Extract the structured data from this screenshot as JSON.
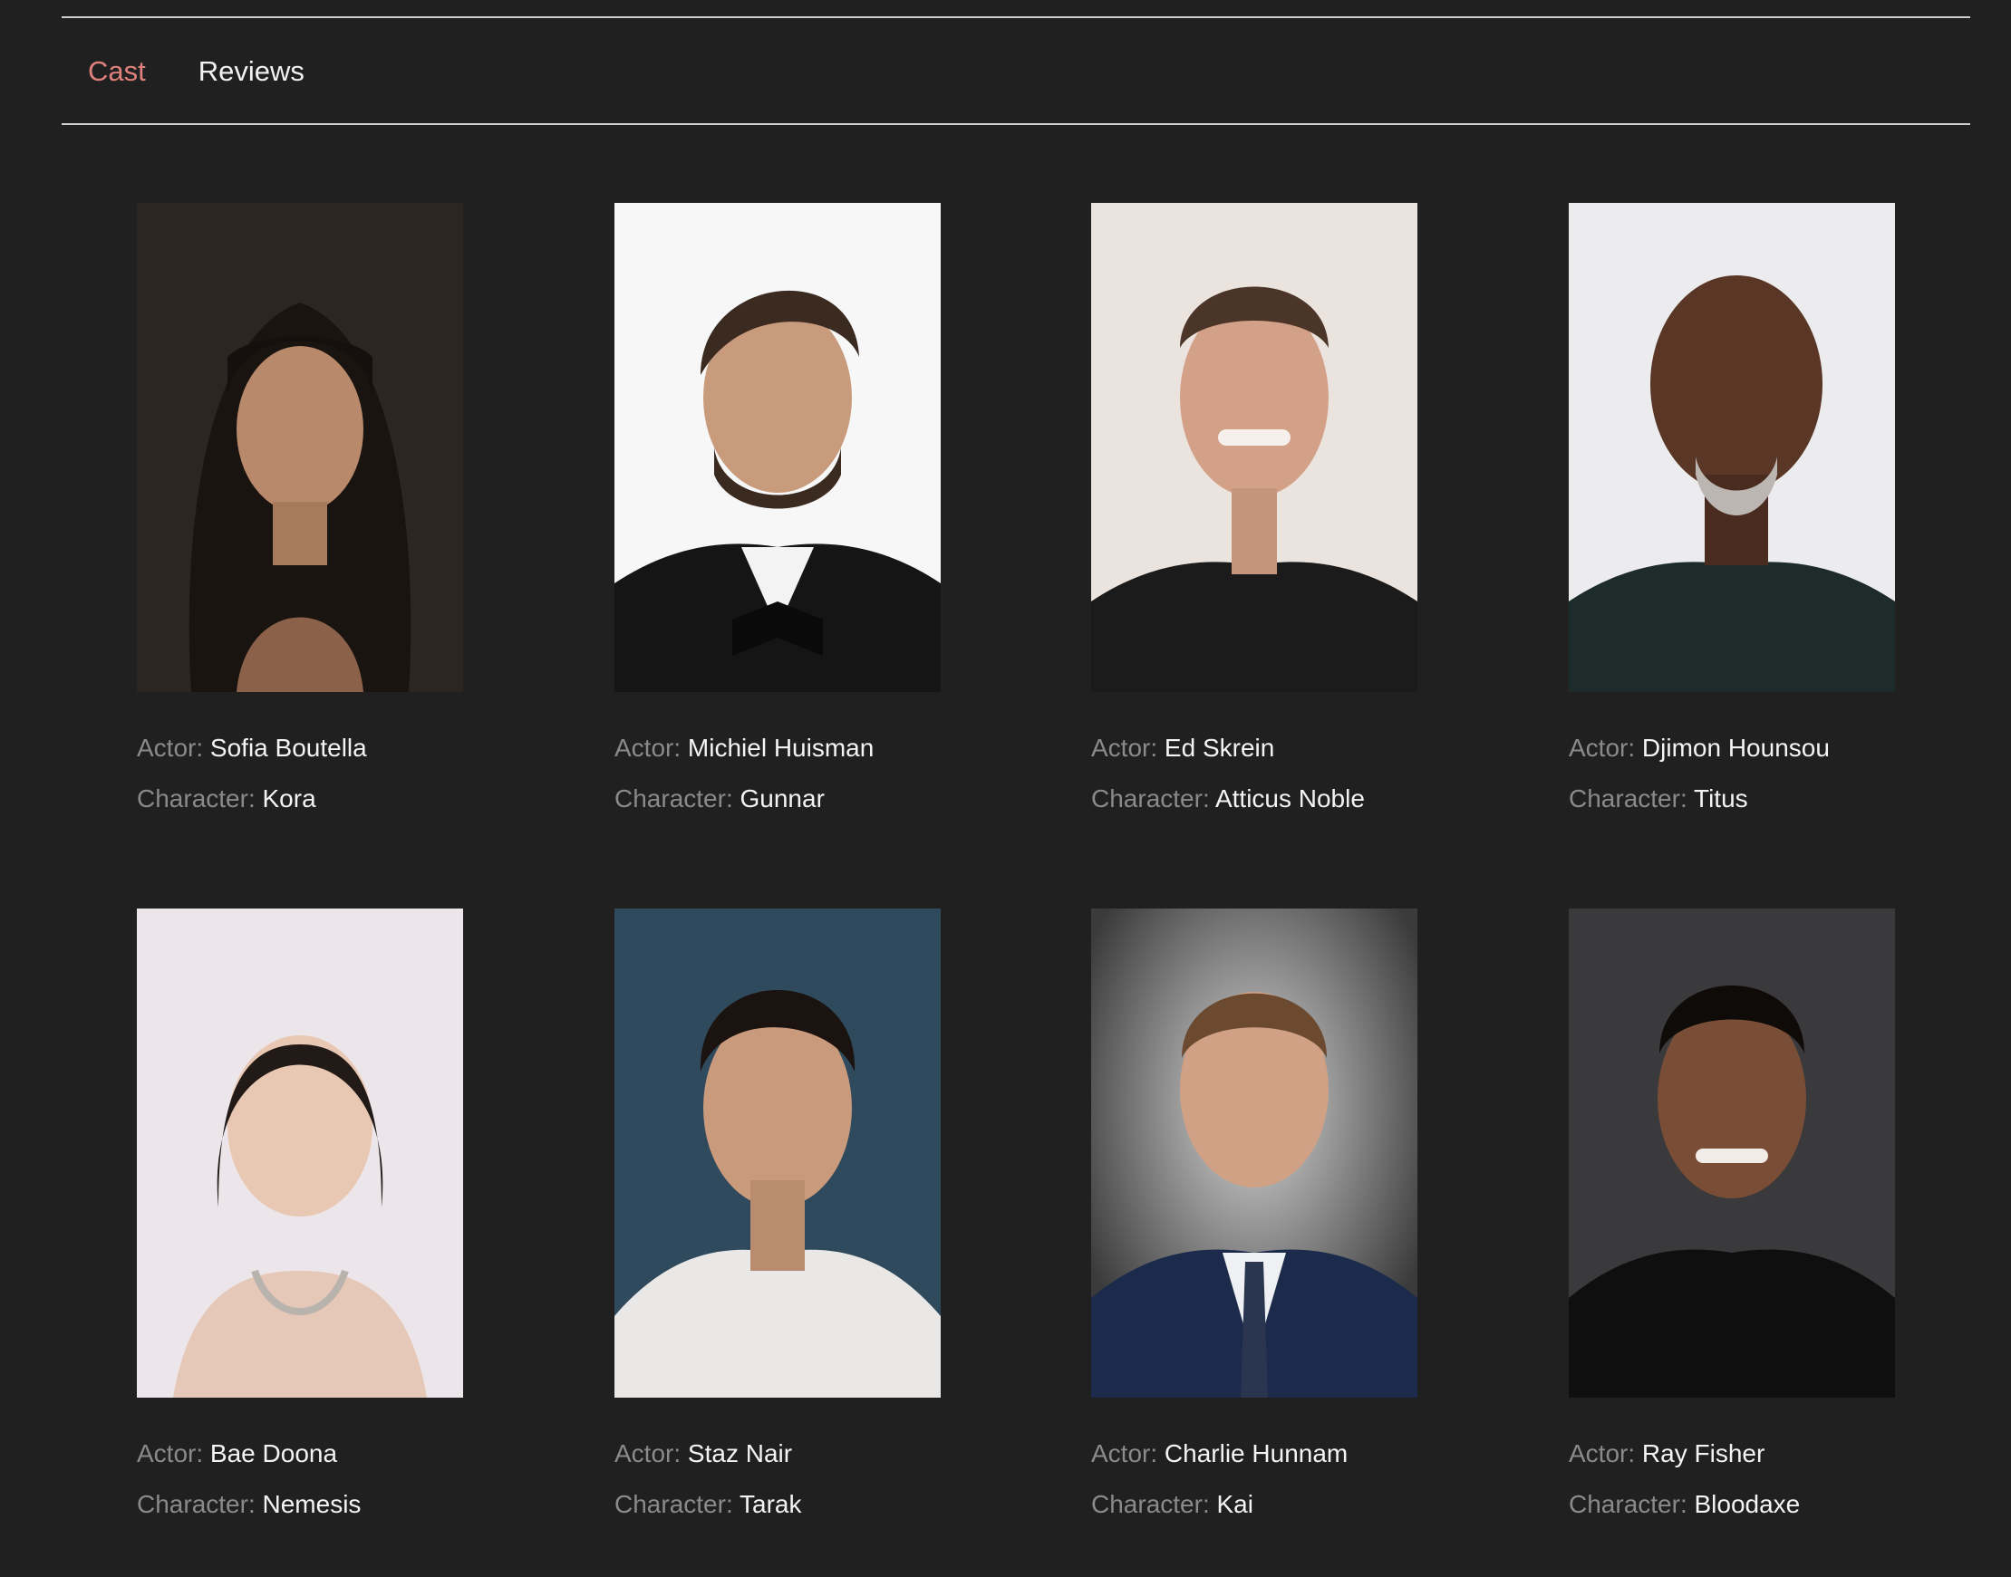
{
  "tabs": [
    {
      "label": "Cast",
      "active": true
    },
    {
      "label": "Reviews",
      "active": false
    }
  ],
  "labels": {
    "actor": "Actor:",
    "character": "Character:"
  },
  "colors": {
    "background": "#202020",
    "accent": "#e0807c",
    "label": "#8a8a8a",
    "value": "#f4f4f4",
    "rule": "#cfcfcf"
  },
  "cast": [
    {
      "actor": "Sofia Boutella",
      "character": "Kora"
    },
    {
      "actor": "Michiel Huisman",
      "character": "Gunnar"
    },
    {
      "actor": "Ed Skrein",
      "character": "Atticus Noble"
    },
    {
      "actor": "Djimon Hounsou",
      "character": "Titus"
    },
    {
      "actor": "Bae Doona",
      "character": "Nemesis"
    },
    {
      "actor": "Staz Nair",
      "character": "Tarak"
    },
    {
      "actor": "Charlie Hunnam",
      "character": "Kai"
    },
    {
      "actor": "Ray Fisher",
      "character": "Bloodaxe"
    }
  ]
}
